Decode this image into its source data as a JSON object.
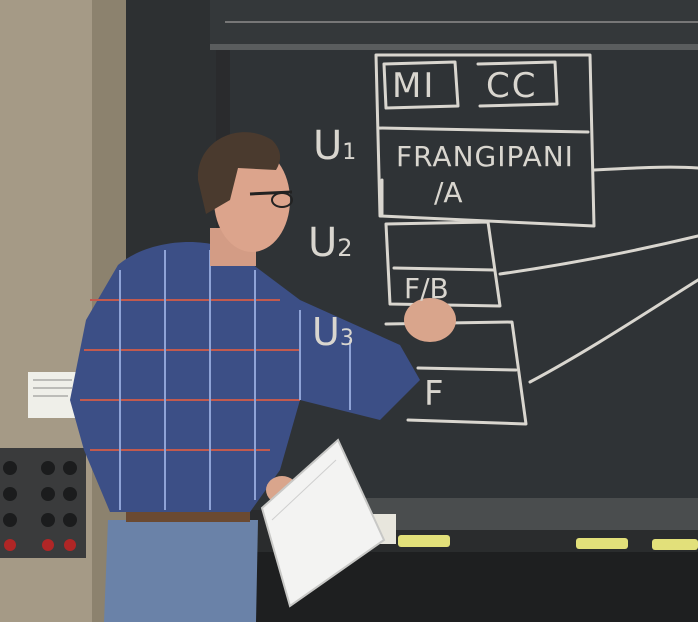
{
  "board": {
    "labels": {
      "u1": "U",
      "u1_sub": "1",
      "u2": "U",
      "u2_sub": "2",
      "u3": "U",
      "u3_sub": "3"
    },
    "box1": {
      "tag_left": "MI",
      "tag_right": "CC",
      "line1": "FRANGIPANI",
      "line2": "/A"
    },
    "box2": {
      "line": "F/B"
    },
    "box3": {
      "line": "F"
    }
  },
  "colors": {
    "chalk": "#d9d6cf",
    "board": "#2f3336",
    "wall": "#a59a86",
    "shirt": "#3c4f86",
    "jeans": "#6a82a8"
  }
}
